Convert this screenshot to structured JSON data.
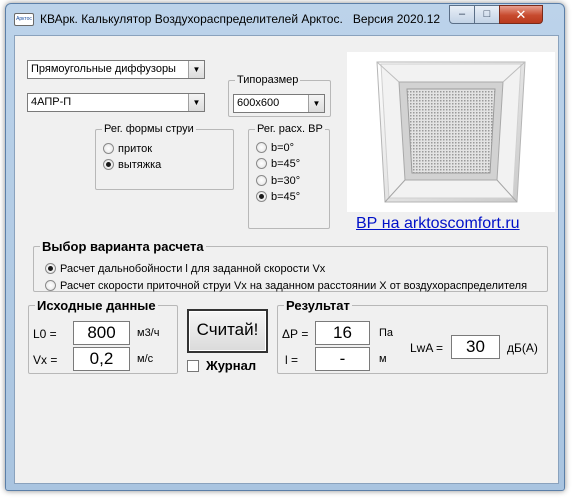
{
  "window": {
    "title": "КВАрк. Калькулятор Воздухораспределителей Арктос.",
    "version": "Версия 2020.12",
    "app_icon_text": "Арктос",
    "min_label": "–",
    "max_label": "□",
    "close_label": "✕"
  },
  "diffuser_type": {
    "selected": "Прямоугольные диффузоры"
  },
  "model": {
    "selected": "4АПР-П"
  },
  "size": {
    "legend": "Типоразмер",
    "selected": "600х600"
  },
  "jet_shape": {
    "legend": "Рег. формы струи",
    "options": [
      {
        "label": "приток",
        "checked": false
      },
      {
        "label": "вытяжка",
        "checked": true
      }
    ]
  },
  "spread": {
    "legend": "Рег. расх. ВР",
    "options": [
      {
        "label": "b=0°",
        "checked": false
      },
      {
        "label": "b=45°",
        "checked": false
      },
      {
        "label": "b=30°",
        "checked": false
      },
      {
        "label": "b=45°",
        "checked": true
      }
    ]
  },
  "promo": {
    "link_text": "ВР на arktoscomfort.ru"
  },
  "calc_variant": {
    "legend": "Выбор варианта расчета",
    "options": [
      {
        "label": "Расчет дальнобойности l для заданной скорости Vx",
        "checked": true
      },
      {
        "label": "Расчет скорости приточной струи Vx на заданном расстоянии X от воздухораспределителя",
        "checked": false
      }
    ]
  },
  "input_data": {
    "legend": "Исходные данные",
    "l0": {
      "label": "L0 =",
      "value": "800",
      "unit": "м3/ч"
    },
    "vx": {
      "label": "Vx =",
      "value": "0,2",
      "unit": "м/с"
    }
  },
  "calculate": {
    "label": "Считай!"
  },
  "journal": {
    "label": "Журнал",
    "checked": false
  },
  "result": {
    "legend": "Результат",
    "dp": {
      "label": "ΔР =",
      "value": "16",
      "unit": "Па"
    },
    "l": {
      "label": "l =",
      "value": "-",
      "unit": "м"
    },
    "lwa": {
      "label": "LwA =",
      "value": "30",
      "unit": "дБ(А)"
    }
  }
}
